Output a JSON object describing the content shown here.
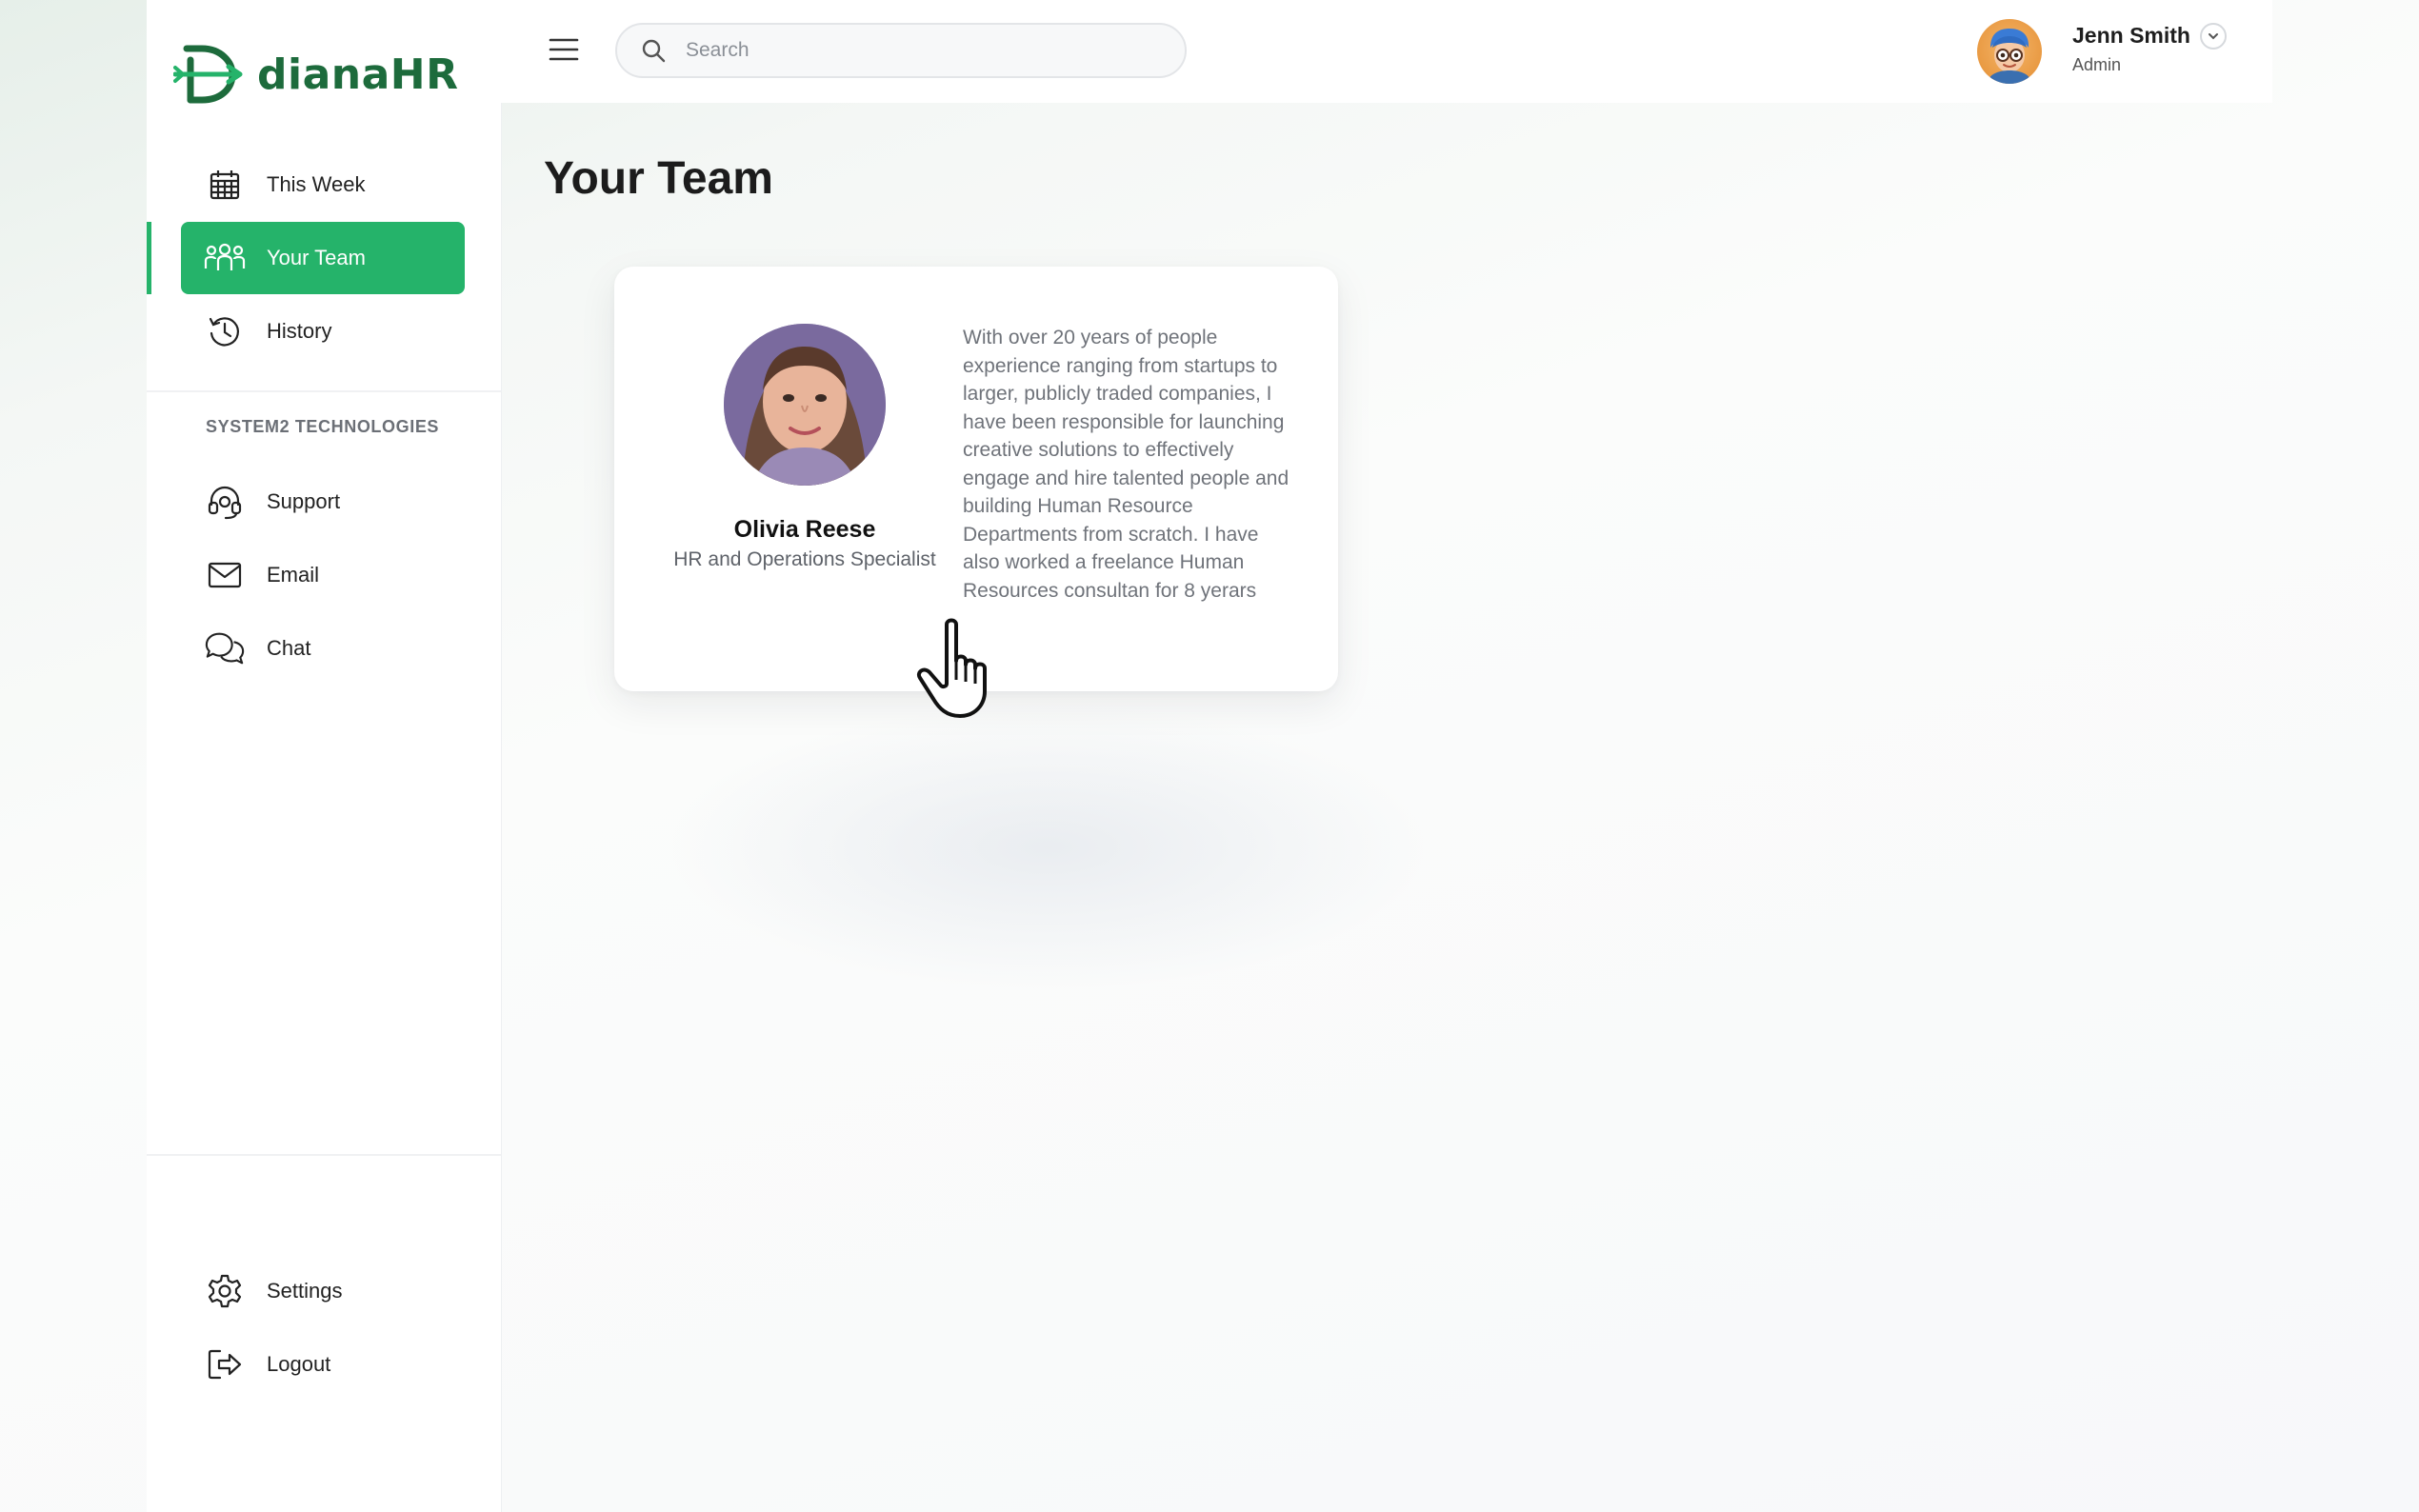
{
  "app": {
    "name": "dianaHR",
    "brand_color": "#25b36a",
    "logo_color": "#1d6b3c"
  },
  "sidebar": {
    "items": [
      {
        "label": "This Week",
        "icon": "calendar-icon",
        "active": false
      },
      {
        "label": "Your Team",
        "icon": "team-icon",
        "active": true
      },
      {
        "label": "History",
        "icon": "history-icon",
        "active": false
      }
    ],
    "section_label": "SYSTEM2 TECHNOLOGIES",
    "section_items": [
      {
        "label": "Support",
        "icon": "headset-icon"
      },
      {
        "label": "Email",
        "icon": "mail-icon"
      },
      {
        "label": "Chat",
        "icon": "chat-icon"
      }
    ],
    "bottom_items": [
      {
        "label": "Settings",
        "icon": "gear-icon"
      },
      {
        "label": "Logout",
        "icon": "logout-icon"
      }
    ]
  },
  "header": {
    "search_placeholder": "Search",
    "user": {
      "name": "Jenn Smith",
      "role": "Admin"
    }
  },
  "main": {
    "title": "Your Team",
    "members": [
      {
        "name": "Olivia Reese",
        "role": "HR and Operations Specialist",
        "bio": "With over 20 years of people experience ranging from startups to larger, publicly traded companies, I have been responsible for launching creative solutions to effectively engage and hire talented people and  building Human Resource Departments from scratch. I have also worked a freelance Human Resources consultan for 8 yerars"
      }
    ]
  }
}
